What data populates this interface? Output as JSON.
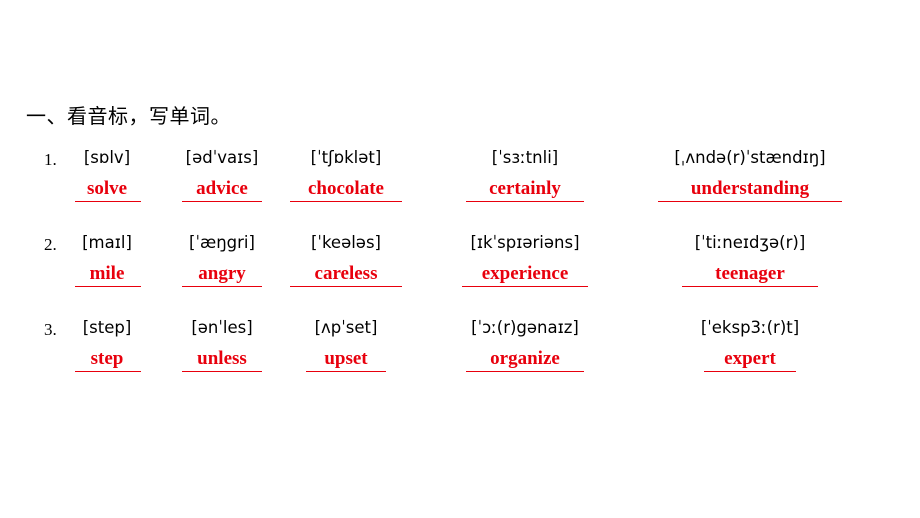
{
  "document": {
    "title": "一、看音标，写单词。",
    "accent_color": "#e8000d",
    "rows": [
      {
        "number": "1.",
        "items": [
          {
            "phonetic": "[sɒlv]",
            "answer": "solve"
          },
          {
            "phonetic": "[ədˈvaɪs]",
            "answer": "advice"
          },
          {
            "phonetic": "[ˈtʃɒklət]",
            "answer": "chocolate"
          },
          {
            "phonetic": "[ˈsɜːtnli]",
            "answer": "certainly"
          },
          {
            "phonetic": "[ˌʌndə(r)ˈstændɪŋ]",
            "answer": "understanding"
          }
        ]
      },
      {
        "number": "2.",
        "items": [
          {
            "phonetic": "[maɪl]",
            "answer": "mile"
          },
          {
            "phonetic": "[ˈæŋgri]",
            "answer": "angry"
          },
          {
            "phonetic": "[ˈkeələs]",
            "answer": "careless"
          },
          {
            "phonetic": "[ɪkˈspɪəriəns]",
            "answer": "experience"
          },
          {
            "phonetic": "[ˈtiːneɪdʒə(r)]",
            "answer": "teenager"
          }
        ]
      },
      {
        "number": "3.",
        "items": [
          {
            "phonetic": "[step]",
            "answer": "step"
          },
          {
            "phonetic": "[ənˈles]",
            "answer": "unless"
          },
          {
            "phonetic": "[ʌpˈset]",
            "answer": "upset"
          },
          {
            "phonetic": "[ˈɔː(r)gənaɪz]",
            "answer": "organize"
          },
          {
            "phonetic": "[ˈeksp3ː(r)t]",
            "answer": "expert"
          }
        ]
      }
    ]
  }
}
